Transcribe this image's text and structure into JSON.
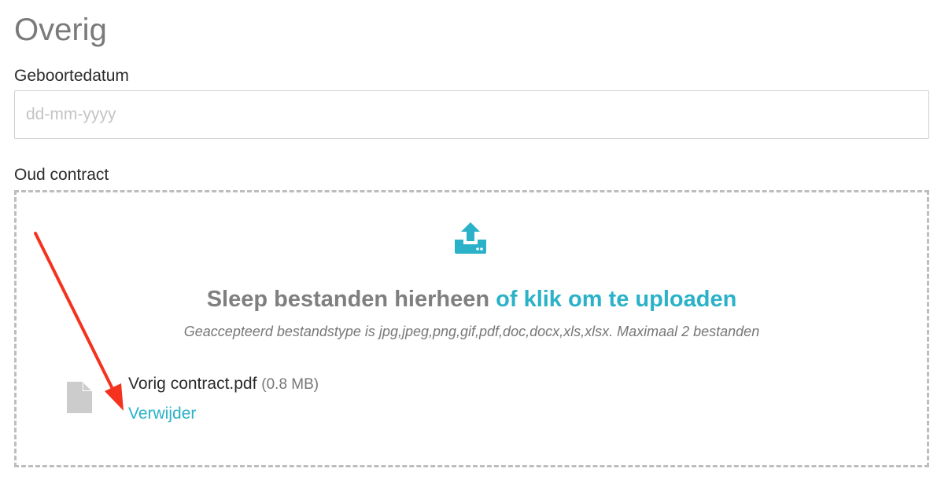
{
  "section": {
    "title": "Overig"
  },
  "birthdate": {
    "label": "Geboortedatum",
    "value": "",
    "placeholder": "dd-mm-yyyy"
  },
  "contract": {
    "label": "Oud contract",
    "dropzone": {
      "icon": "upload-icon",
      "text_main": "Sleep bestanden hierheen ",
      "text_link": "of klik om te uploaden",
      "hint": "Geaccepteerd bestandstype is jpg,jpeg,png,gif,pdf,doc,docx,xls,xlsx. Maximaal 2 bestanden"
    },
    "files": [
      {
        "icon": "file-icon",
        "name": "Vorig contract.pdf",
        "size": "(0.8 MB)",
        "remove_label": "Verwijder"
      }
    ]
  },
  "colors": {
    "accent": "#2bb2c8",
    "annotation_arrow": "#f4321e",
    "muted_text": "#7f7f7f",
    "border": "#bdbdbd"
  }
}
